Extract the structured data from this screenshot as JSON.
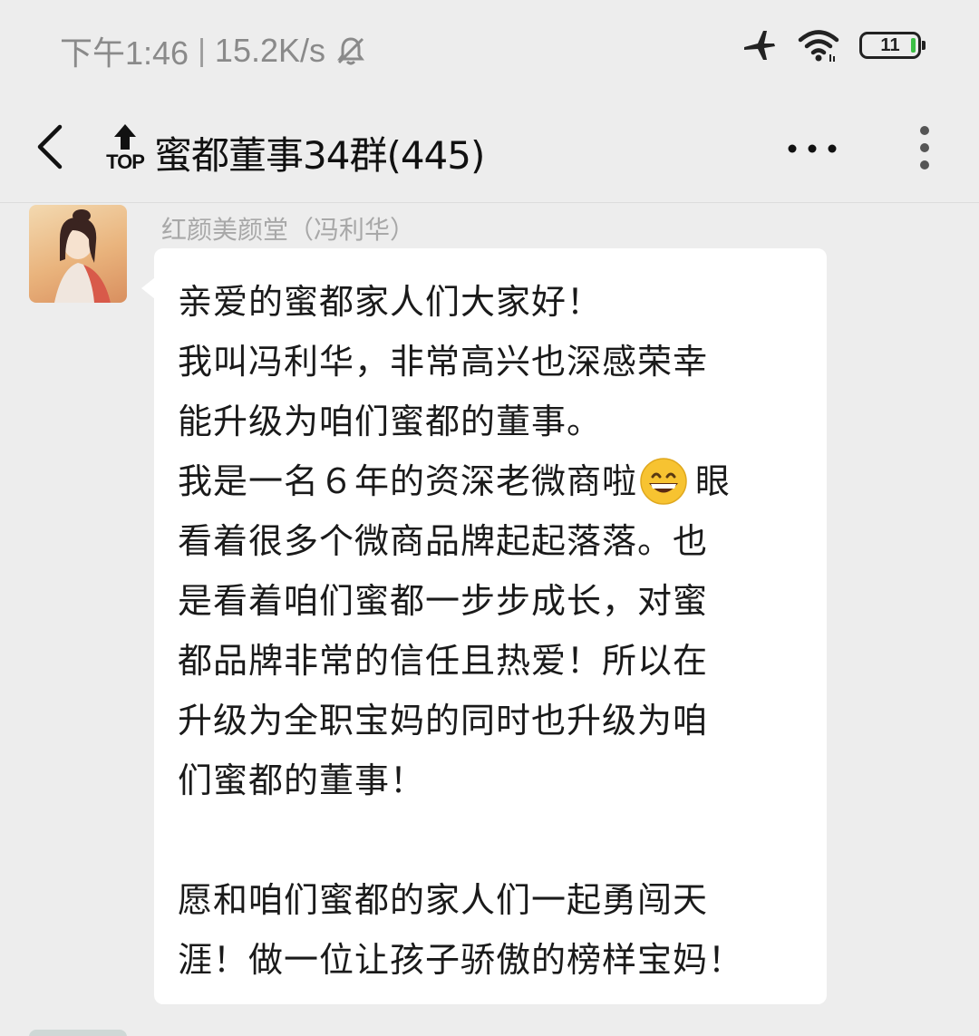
{
  "status_bar": {
    "time": "下午1:46",
    "net_speed": "15.2K/s",
    "battery_level": "11",
    "icons": [
      "mute-bell-icon",
      "airplane-icon",
      "wifi-icon",
      "battery-icon"
    ]
  },
  "header": {
    "top_badge": "TOP",
    "title": "蜜都董事34群(445)"
  },
  "message": {
    "sender": "红颜美颜堂（冯利华）",
    "lines": [
      "亲爱的蜜都家人们大家好！",
      "我叫冯利华，非常高兴也深感荣幸",
      "能升级为咱们蜜都的董事。",
      "我是一名６年的资深老微商啦",
      "眼",
      "看着很多个微商品牌起起落落。也",
      "是看着咱们蜜都一步步成长，对蜜",
      "都品牌非常的信任且热爱！所以在",
      "升级为全职宝妈的同时也升级为咱",
      "们蜜都的董事！",
      "",
      "愿和咱们蜜都的家人们一起勇闯天",
      "涯！做一位让孩子骄傲的榜样宝妈！"
    ],
    "emoji": "grinning-face"
  },
  "colors": {
    "background": "#ededed",
    "bubble": "#ffffff",
    "battery_fill": "#3cbf45",
    "emoji": "#f7c331"
  }
}
